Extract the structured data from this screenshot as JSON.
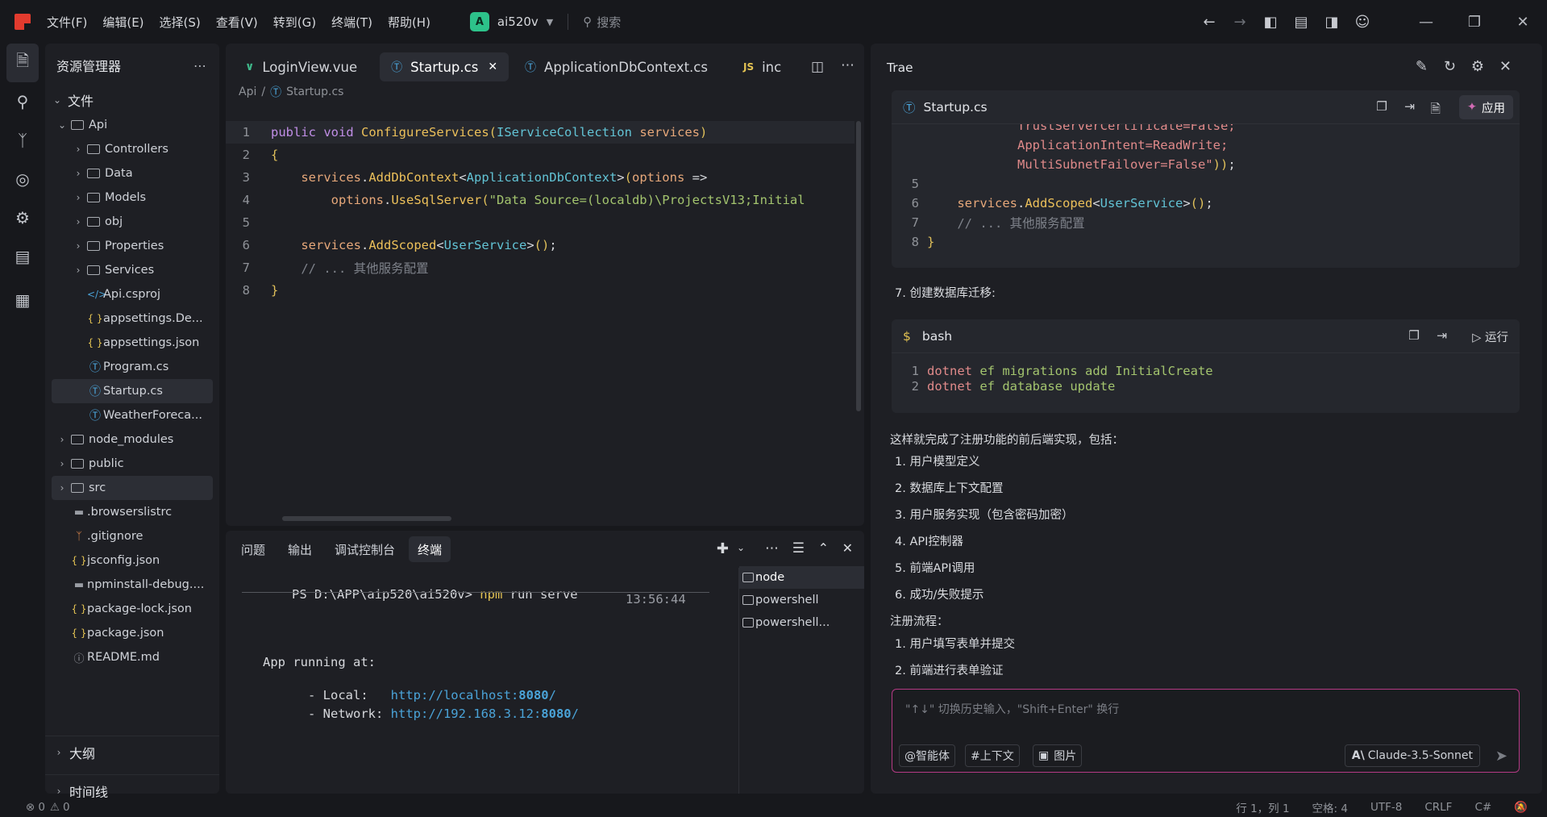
{
  "menu": [
    "文件(F)",
    "编辑(E)",
    "选择(S)",
    "查看(V)",
    "转到(G)",
    "终端(T)",
    "帮助(H)"
  ],
  "project": {
    "badge": "A",
    "name": "ai520v"
  },
  "search_placeholder": "搜索",
  "explorer": {
    "title": "资源管理器",
    "section": "文件",
    "tree": [
      {
        "label": "Api",
        "kind": "folder",
        "depth": 1,
        "open": true
      },
      {
        "label": "Controllers",
        "kind": "folder",
        "depth": 2
      },
      {
        "label": "Data",
        "kind": "folder",
        "depth": 2
      },
      {
        "label": "Models",
        "kind": "folder",
        "depth": 2
      },
      {
        "label": "obj",
        "kind": "folder",
        "depth": 2
      },
      {
        "label": "Properties",
        "kind": "folder",
        "depth": 2
      },
      {
        "label": "Services",
        "kind": "folder",
        "depth": 2
      },
      {
        "label": "Api.csproj",
        "kind": "xml",
        "depth": 2
      },
      {
        "label": "appsettings.De...",
        "kind": "json",
        "depth": 2
      },
      {
        "label": "appsettings.json",
        "kind": "json",
        "depth": 2
      },
      {
        "label": "Program.cs",
        "kind": "cs",
        "depth": 2
      },
      {
        "label": "Startup.cs",
        "kind": "cs",
        "depth": 2,
        "selected": true
      },
      {
        "label": "WeatherForeca...",
        "kind": "cs",
        "depth": 2
      },
      {
        "label": "node_modules",
        "kind": "folder",
        "depth": 1
      },
      {
        "label": "public",
        "kind": "folder",
        "depth": 1
      },
      {
        "label": "src",
        "kind": "folder",
        "depth": 1,
        "selected": true
      },
      {
        "label": ".browserslistrc",
        "kind": "doc",
        "depth": 1
      },
      {
        "label": ".gitignore",
        "kind": "git",
        "depth": 1
      },
      {
        "label": "jsconfig.json",
        "kind": "json",
        "depth": 1
      },
      {
        "label": "npminstall-debug....",
        "kind": "doc",
        "depth": 1
      },
      {
        "label": "package-lock.json",
        "kind": "json",
        "depth": 1
      },
      {
        "label": "package.json",
        "kind": "json",
        "depth": 1
      },
      {
        "label": "README.md",
        "kind": "info",
        "depth": 1
      }
    ],
    "outline": "大纲",
    "timeline": "时间线"
  },
  "editor": {
    "tabs": [
      {
        "label": "LoginView.vue",
        "icon": "V"
      },
      {
        "label": "Startup.cs",
        "icon": "C#",
        "active": true
      },
      {
        "label": "ApplicationDbContext.cs",
        "icon": "C#"
      },
      {
        "label": "inc",
        "icon": "JS"
      }
    ],
    "breadcrumb": [
      "Api",
      "Startup.cs"
    ],
    "lines": [
      [
        [
          "k",
          "public"
        ],
        [
          "p",
          " "
        ],
        [
          "k",
          "void"
        ],
        [
          "p",
          " "
        ],
        [
          "f",
          "ConfigureServices"
        ],
        [
          "br",
          "("
        ],
        [
          "t",
          "IServiceCollection"
        ],
        [
          "p",
          " "
        ],
        [
          "v",
          "services"
        ],
        [
          "br",
          ")"
        ]
      ],
      [
        [
          "br",
          "{"
        ]
      ],
      [
        [
          "p",
          "    "
        ],
        [
          "v",
          "services"
        ],
        [
          "p",
          "."
        ],
        [
          "f",
          "AddDbContext"
        ],
        [
          "p",
          "<"
        ],
        [
          "t",
          "ApplicationDbContext"
        ],
        [
          "p",
          ">"
        ],
        [
          "br",
          "("
        ],
        [
          "v",
          "options"
        ],
        [
          "p",
          " =>"
        ]
      ],
      [
        [
          "p",
          "        "
        ],
        [
          "v",
          "options"
        ],
        [
          "p",
          "."
        ],
        [
          "f",
          "UseSqlServer"
        ],
        [
          "br",
          "("
        ],
        [
          "s",
          "\"Data Source=(localdb)\\ProjectsV13;Initial"
        ]
      ],
      [],
      [
        [
          "p",
          "    "
        ],
        [
          "v",
          "services"
        ],
        [
          "p",
          "."
        ],
        [
          "f",
          "AddScoped"
        ],
        [
          "p",
          "<"
        ],
        [
          "t",
          "UserService"
        ],
        [
          "p",
          ">"
        ],
        [
          "br",
          "("
        ],
        [
          "br",
          ")"
        ],
        [
          "p",
          ";"
        ]
      ],
      [
        [
          "cm",
          "    // ... 其他服务配置"
        ]
      ],
      [
        [
          "br",
          "}"
        ]
      ]
    ]
  },
  "panel": {
    "tabs": [
      "问题",
      "输出",
      "调试控制台",
      "终端"
    ],
    "active_tab": "终端",
    "prompt": "PS D:\\APP\\aip520\\ai520v> ",
    "command": "npm run serve",
    "time": "13:56:44",
    "app_running": "App running at:",
    "local_label": "- Local:   ",
    "local_url": "http://localhost:",
    "local_port": "8080",
    "network_label": "- Network: ",
    "network_url": "http://192.168.3.12:",
    "network_port": "8080",
    "terminals": [
      "node",
      "powershell",
      "powershell..."
    ]
  },
  "chat": {
    "title": "Trae",
    "code1": {
      "file": "Startup.cs",
      "apply": "应用",
      "lines": [
        {
          "ln": "",
          "segs": [
            [
              "p",
              "            "
            ],
            [
              "n",
              "TrustServerCertificate=False;"
            ]
          ]
        },
        {
          "ln": "",
          "segs": [
            [
              "p",
              "            "
            ],
            [
              "n",
              "ApplicationIntent=ReadWrite;"
            ]
          ]
        },
        {
          "ln": "",
          "segs": [
            [
              "p",
              "            "
            ],
            [
              "n",
              "MultiSubnetFailover=False\""
            ],
            [
              "br",
              ")"
            ],
            [
              "br",
              ")"
            ],
            [
              "p",
              ";"
            ]
          ]
        },
        {
          "ln": "5",
          "segs": []
        },
        {
          "ln": "6",
          "segs": [
            [
              "p",
              "    "
            ],
            [
              "v",
              "services"
            ],
            [
              "p",
              "."
            ],
            [
              "f",
              "AddScoped"
            ],
            [
              "p",
              "<"
            ],
            [
              "t",
              "UserService"
            ],
            [
              "p",
              ">"
            ],
            [
              "br",
              "("
            ],
            [
              "br",
              ")"
            ],
            [
              "p",
              ";"
            ]
          ]
        },
        {
          "ln": "7",
          "segs": [
            [
              "cm",
              "    // ... 其他服务配置"
            ]
          ]
        },
        {
          "ln": "8",
          "segs": [
            [
              "br",
              "}"
            ]
          ]
        }
      ]
    },
    "step7": "7. 创建数据库迁移:",
    "code2": {
      "lang": "bash",
      "run": "运行",
      "lines": [
        {
          "ln": "1",
          "segs": [
            [
              "n",
              "dotnet"
            ],
            [
              "p",
              " "
            ],
            [
              "s",
              "ef migrations add InitialCreate"
            ]
          ]
        },
        {
          "ln": "2",
          "segs": [
            [
              "n",
              "dotnet"
            ],
            [
              "p",
              " "
            ],
            [
              "s",
              "ef database update"
            ]
          ]
        }
      ]
    },
    "summary": "这样就完成了注册功能的前后端实现，包括：",
    "list1": [
      "1. 用户模型定义",
      "2. 数据库上下文配置",
      "3. 用户服务实现（包含密码加密）",
      "4. API控制器",
      "5. 前端API调用",
      "6. 成功/失败提示"
    ],
    "flow_title": "注册流程：",
    "list2": [
      "1. 用户填写表单并提交",
      "2. 前端进行表单验证"
    ],
    "input_placeholder": "\"↑↓\" 切换历史输入，\"Shift+Enter\" 换行",
    "btn_agent": "@智能体",
    "btn_context": "#上下文",
    "btn_image": "图片",
    "model": "Claude-3.5-Sonnet"
  },
  "status": {
    "errors": "0",
    "warnings": "0",
    "position": "行 1，列 1",
    "spaces": "空格: 4",
    "encoding": "UTF-8",
    "eol": "CRLF",
    "lang": "C#"
  }
}
